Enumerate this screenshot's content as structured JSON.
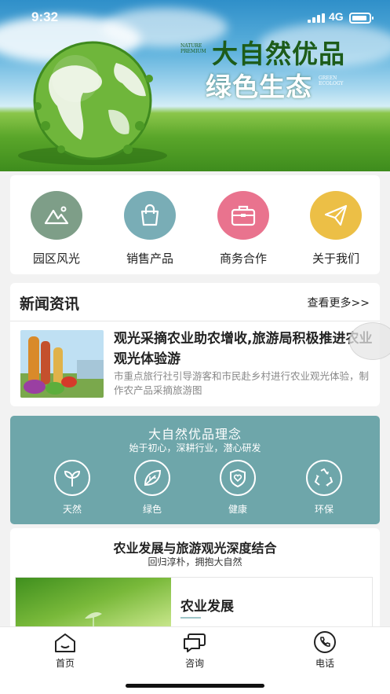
{
  "status_bar": {
    "time": "9:32",
    "network": "4G"
  },
  "banner": {
    "slogan_line1": "大自然优品",
    "slogan_line2": "绿色生态",
    "tag_nature": "NATURE PREMIUM",
    "tag_green": "GREEN ECOLOGY"
  },
  "menu": {
    "items": [
      {
        "label": "园区风光",
        "icon": "mountain-photo-icon",
        "color": "#7e9e88"
      },
      {
        "label": "销售产品",
        "icon": "shopping-bag-icon",
        "color": "#79adb6"
      },
      {
        "label": "商务合作",
        "icon": "briefcase-icon",
        "color": "#e9738e"
      },
      {
        "label": "关于我们",
        "icon": "paper-plane-icon",
        "color": "#ecbf46"
      }
    ]
  },
  "news": {
    "title": "新闻资讯",
    "more": "查看更多>>",
    "item": {
      "headline": "观光采摘农业助农增收,旅游局积极推进农业观光体验游",
      "desc": "市重点旅行社引导游客和市民赴乡村进行农业观光体验，制作农产品采摘旅游图"
    }
  },
  "concept": {
    "title": "大自然优品理念",
    "subtitle": "始于初心，深耕行业，潜心研发",
    "bg_color": "#6ea6aa",
    "items": [
      {
        "label": "天然",
        "icon": "sprout-icon"
      },
      {
        "label": "绿色",
        "icon": "leaf-icon"
      },
      {
        "label": "健康",
        "icon": "shield-heart-icon"
      },
      {
        "label": "环保",
        "icon": "recycle-icon"
      }
    ]
  },
  "feature": {
    "title": "农业发展与旅游观光深度结合",
    "subtitle": "回归淳朴，拥抱大自然",
    "card_title": "农业发展"
  },
  "tabbar": {
    "items": [
      {
        "label": "首页",
        "icon": "home-icon"
      },
      {
        "label": "咨询",
        "icon": "chat-icon"
      },
      {
        "label": "电话",
        "icon": "phone-icon"
      }
    ]
  }
}
